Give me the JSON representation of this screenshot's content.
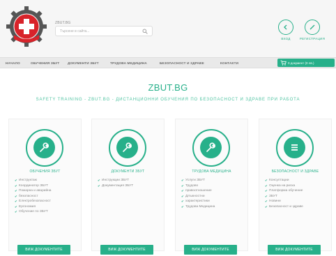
{
  "header": {
    "site_name": "ZBUT.BG",
    "search_placeholder": "Търсене в сайта...",
    "login_label": "ВХОД",
    "register_label": "РЕГИСТРАЦИЯ"
  },
  "nav": {
    "items": [
      "НАЧАЛО",
      "ОБУЧЕНИЯ ЗБУТ",
      "ДОКУМЕНТИ ЗБУТ",
      "ТРУДОВА МЕДИЦИНА",
      "БЕЗОПАСНОСТ И ЗДРАВЕ",
      "КОНТАКТИ"
    ],
    "cart_label": "0 документ (0 лв.)"
  },
  "main": {
    "title": "ZBUT.BG",
    "subtitle": "SAFETY TRAINING - ZBUT.BG - ДИСТАНЦИОННИ ОБУЧЕНИЯ ПО БЕЗОПАСНОСТ И ЗДРАВЕ ПРИ РАБОТА"
  },
  "cards": [
    {
      "title": "ОБУЧЕНИЯ ЗБУТ",
      "icon": "wrench-icon",
      "items": [
        "Инструктаж",
        "Координатор ЗБУТ",
        "Пожарна и аварийна",
        "безопасност",
        "Електробезопасност",
        "Ергономия",
        "Обучение по ЗБУТ"
      ],
      "button": "ВИЖ ДОКУМЕНТИТЕ"
    },
    {
      "title": "ДОКУМЕНТИ ЗБУТ",
      "icon": "wrench-icon",
      "items": [
        "Инструкции ЗБУТ",
        "Документация ЗБУТ"
      ],
      "button": "ВИЖ ДОКУМЕНТИТЕ"
    },
    {
      "title": "ТРУДОВА МЕДИЦИНА",
      "icon": "wrench-icon",
      "items": [
        "Услуги ЗБУТ",
        "Трудово",
        "правоотношение",
        "Длъжностни",
        "характеристики",
        "Трудова Медицина"
      ],
      "button": "ВИЖ ДОКУМЕНТИТЕ"
    },
    {
      "title": "БЕЗОПАСНОСТ И ЗДРАВЕ",
      "icon": "list-icon",
      "items": [
        "Консултации",
        "Оценка на риска",
        "Платформа обучение",
        "ЗБУТ",
        "Новини",
        "Безопасност и здраве"
      ],
      "button": "ВИЖ ДОКУМЕНТИТЕ"
    }
  ],
  "colors": {
    "accent": "#27b08a",
    "header_bg": "#f6f6f6",
    "nav_bg": "#e9e9e9"
  }
}
